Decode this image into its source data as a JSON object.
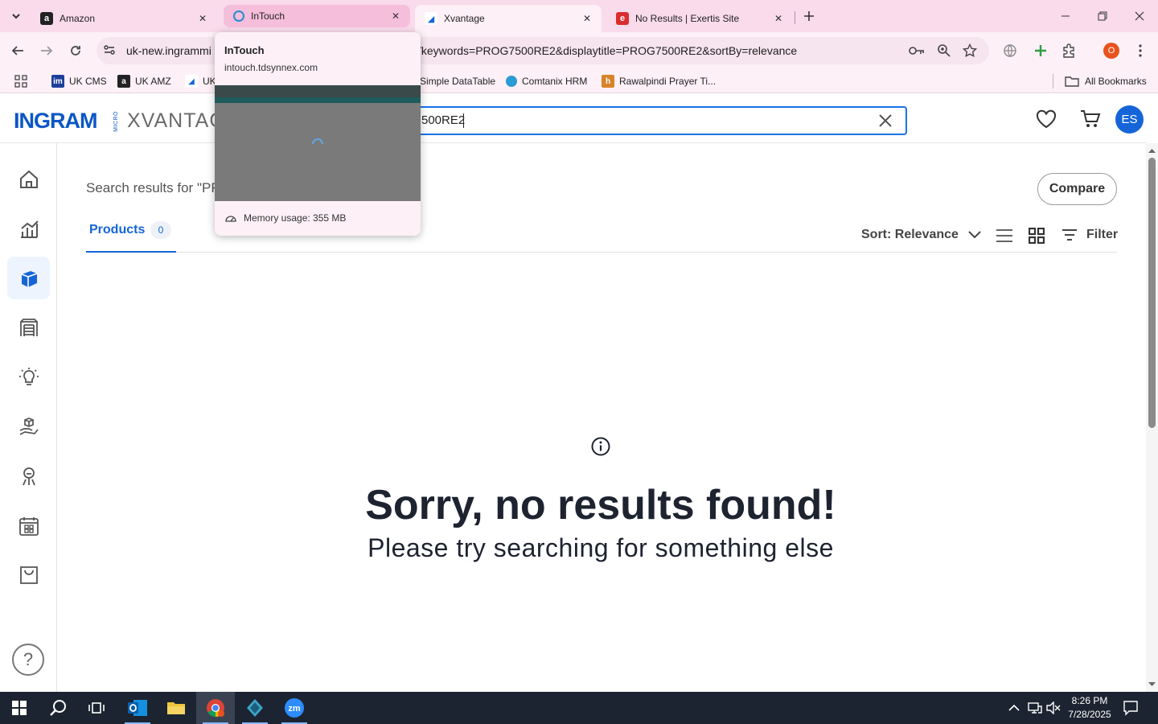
{
  "tabs": [
    {
      "title": "Amazon",
      "favicon": "amazon-icon"
    },
    {
      "title": "InTouch",
      "favicon": "intouch-icon"
    },
    {
      "title": "Xvantage",
      "favicon": "xvantage-icon"
    },
    {
      "title": "No Results | Exertis Site",
      "favicon": "exertis-icon"
    }
  ],
  "address": {
    "left": "uk-new.ingrammi",
    "right": "/keywords=PROG7500RE2&displaytitle=PROG7500RE2&sortBy=relevance"
  },
  "profile_badge": "O",
  "bookmarks": [
    {
      "label": "UK CMS"
    },
    {
      "label": "UK AMZ"
    },
    {
      "label": "UK"
    },
    {
      "label": "Simple DataTable"
    },
    {
      "label": "Comtanix HRM"
    },
    {
      "label": "Rawalpindi Prayer Ti..."
    }
  ],
  "all_bookmarks": "All Bookmarks",
  "header": {
    "logo_main": "INGRAM",
    "logo_micro": "MICRO",
    "logo_sub": "XVANTAG",
    "search_value": "500RE2",
    "avatar": "ES"
  },
  "main": {
    "results_heading": "Search results for \"PR",
    "compare": "Compare",
    "products_tab": "Products",
    "products_count": "0",
    "sort_label": "Sort: Relevance",
    "filter_label": "Filter",
    "empty_title": "Sorry, no results found!",
    "empty_subtitle": "Please try searching for something else"
  },
  "hovercard": {
    "title": "InTouch",
    "url": "intouch.tdsynnex.com",
    "memory": "Memory usage: 355 MB"
  },
  "taskbar": {
    "time": "8:26 PM",
    "date": "7/28/2025"
  }
}
